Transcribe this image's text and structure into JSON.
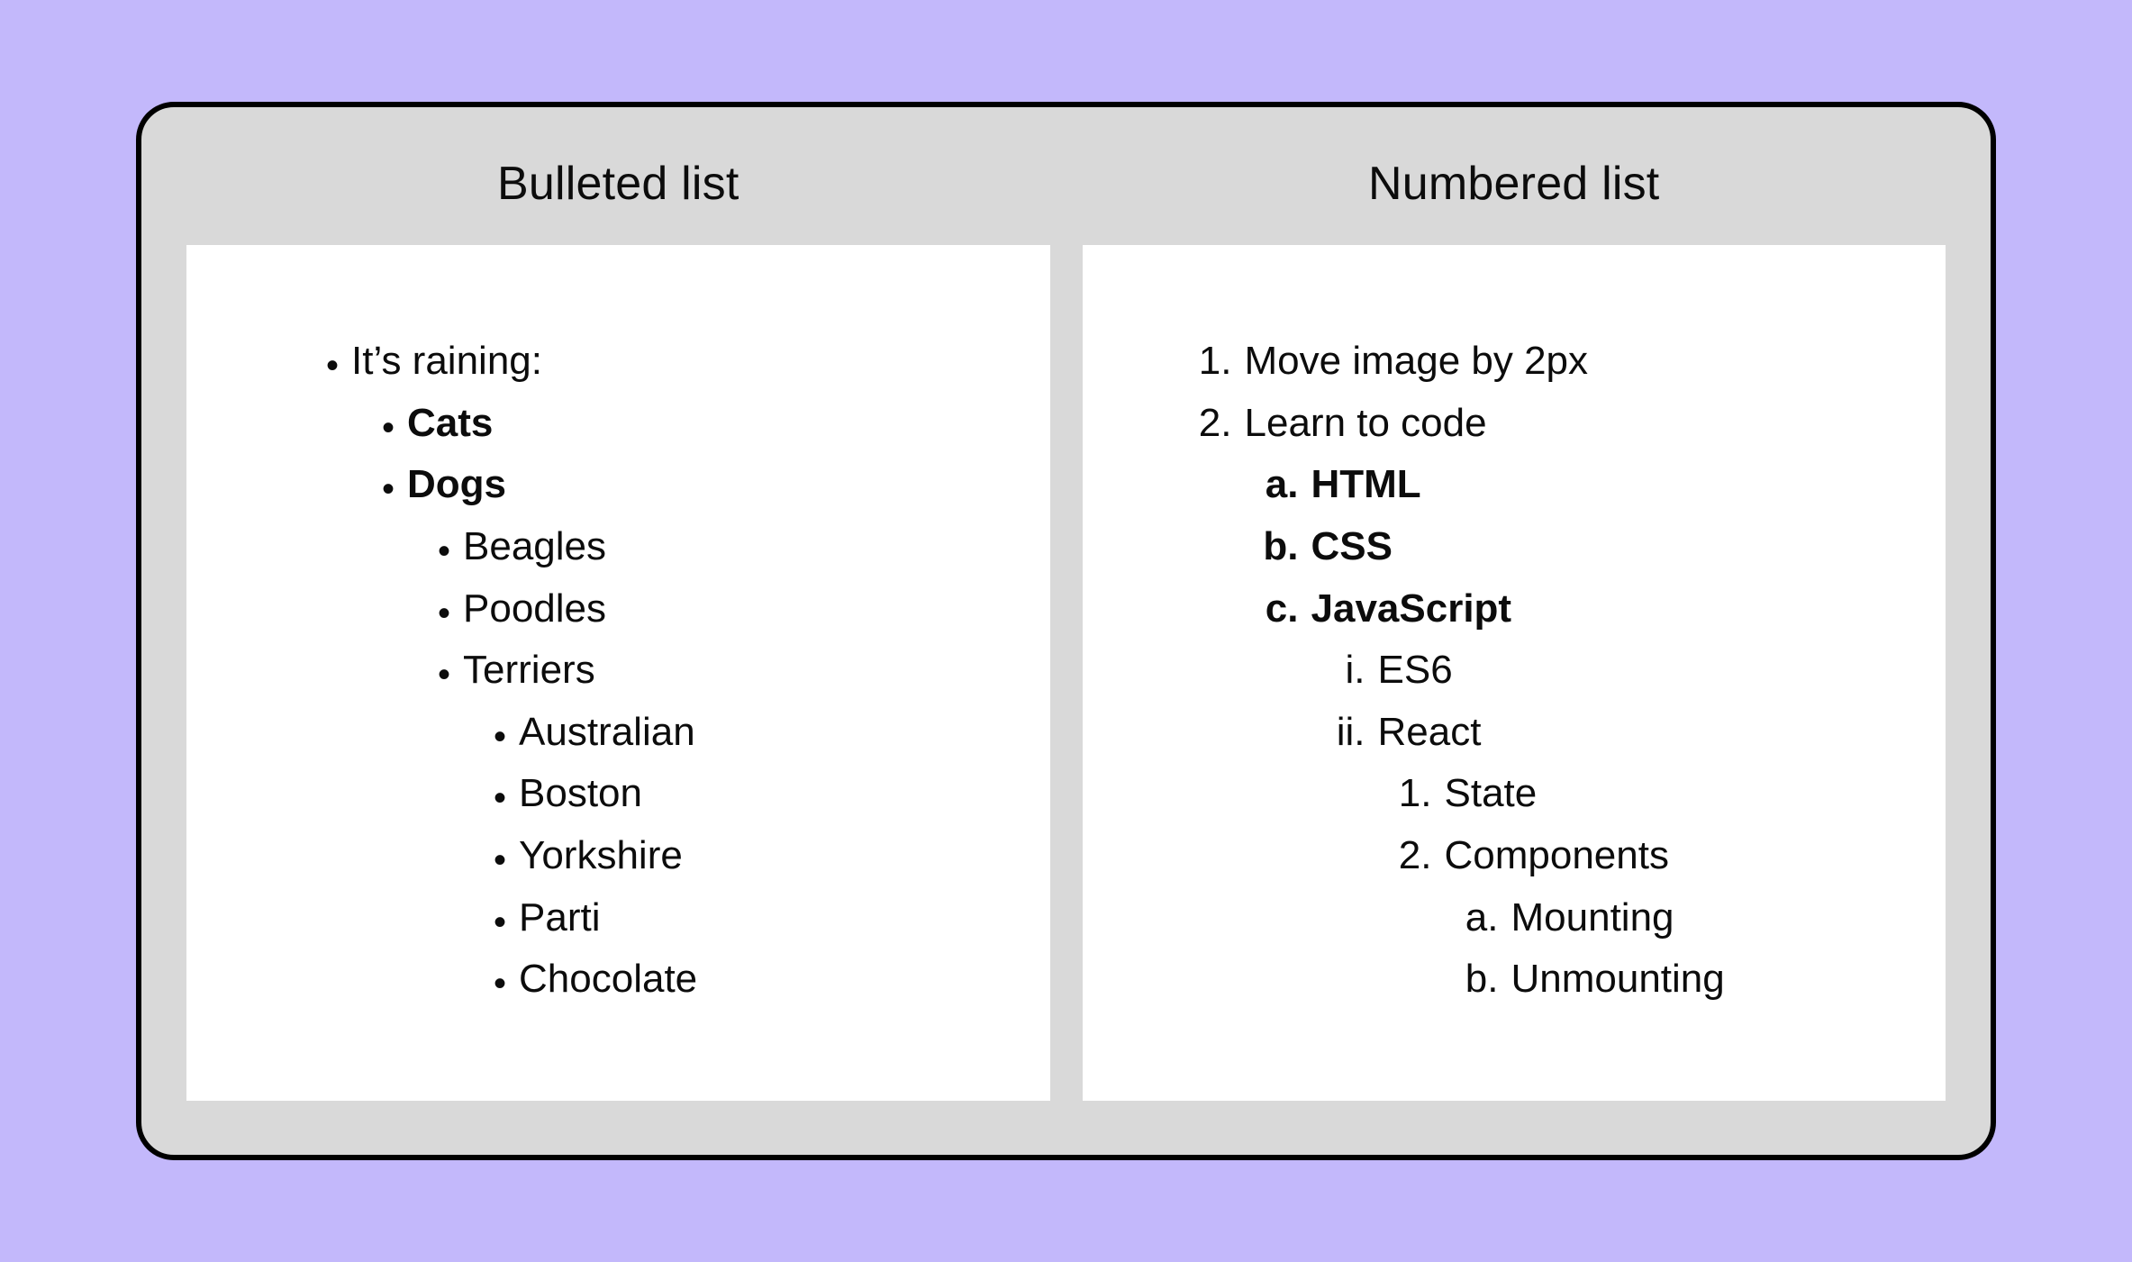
{
  "left": {
    "title": "Bulleted list",
    "items": [
      {
        "level": 0,
        "bold": false,
        "text": "It’s raining:"
      },
      {
        "level": 1,
        "bold": true,
        "text": "Cats"
      },
      {
        "level": 1,
        "bold": true,
        "text": "Dogs"
      },
      {
        "level": 2,
        "bold": false,
        "text": "Beagles"
      },
      {
        "level": 2,
        "bold": false,
        "text": "Poodles"
      },
      {
        "level": 2,
        "bold": false,
        "text": "Terriers"
      },
      {
        "level": 3,
        "bold": false,
        "text": "Australian"
      },
      {
        "level": 3,
        "bold": false,
        "text": "Boston"
      },
      {
        "level": 3,
        "bold": false,
        "text": "Yorkshire"
      },
      {
        "level": 4,
        "bold": false,
        "text": "Parti"
      },
      {
        "level": 4,
        "bold": false,
        "text": "Chocolate"
      }
    ]
  },
  "right": {
    "title": "Numbered list",
    "items": [
      {
        "level": 0,
        "marker": "1.",
        "bold": false,
        "text": "Move image by 2px"
      },
      {
        "level": 0,
        "marker": "2.",
        "bold": false,
        "text": "Learn to code"
      },
      {
        "level": 1,
        "marker": "a.",
        "bold": true,
        "text": "HTML"
      },
      {
        "level": 1,
        "marker": "b.",
        "bold": true,
        "text": "CSS"
      },
      {
        "level": 1,
        "marker": "c.",
        "bold": true,
        "text": "JavaScript"
      },
      {
        "level": 2,
        "marker": "i.",
        "bold": false,
        "text": "ES6"
      },
      {
        "level": 2,
        "marker": "ii.",
        "bold": false,
        "text": "React"
      },
      {
        "level": 3,
        "marker": "1.",
        "bold": false,
        "text": "State"
      },
      {
        "level": 3,
        "marker": "2.",
        "bold": false,
        "text": "Components"
      },
      {
        "level": 4,
        "marker": "a.",
        "bold": false,
        "text": "Mounting"
      },
      {
        "level": 4,
        "marker": "b.",
        "bold": false,
        "text": "Unmounting"
      }
    ]
  }
}
